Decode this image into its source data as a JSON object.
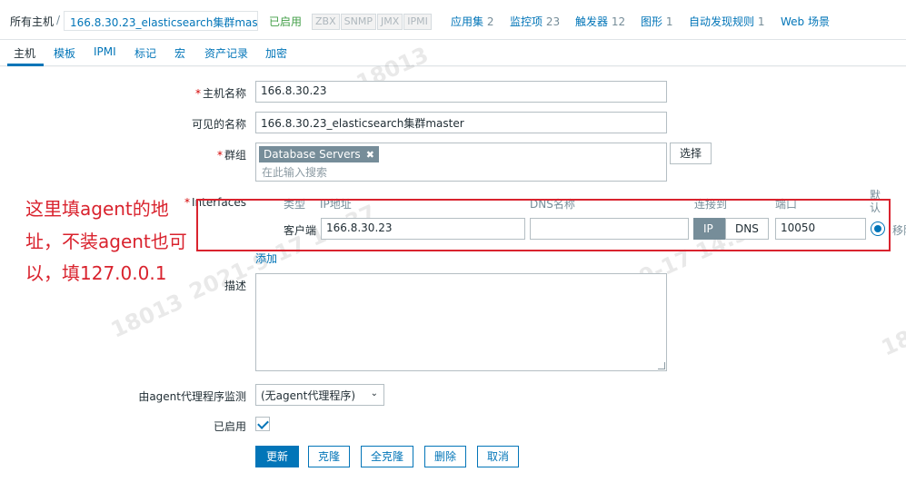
{
  "breadcrumb": {
    "all_hosts": "所有主机",
    "separator": "/",
    "current_host": "166.8.30.23_elasticsearch集群mas..."
  },
  "status": {
    "enabled": "已启用"
  },
  "availability": [
    "ZBX",
    "SNMP",
    "JMX",
    "IPMI"
  ],
  "host_links": [
    {
      "label": "应用集",
      "count": "2"
    },
    {
      "label": "监控项",
      "count": "23"
    },
    {
      "label": "触发器",
      "count": "12"
    },
    {
      "label": "图形",
      "count": "1"
    },
    {
      "label": "自动发现规则",
      "count": "1"
    },
    {
      "label": "Web 场景",
      "count": ""
    }
  ],
  "tabs": [
    "主机",
    "模板",
    "IPMI",
    "标记",
    "宏",
    "资产记录",
    "加密"
  ],
  "form": {
    "hostname_label": "主机名称",
    "hostname_value": "166.8.30.23",
    "visible_name_label": "可见的名称",
    "visible_name_value": "166.8.30.23_elasticsearch集群master",
    "groups_label": "群组",
    "group_chip": "Database Servers",
    "groups_placeholder": "在此输入搜索",
    "select_button": "选择",
    "interfaces_label": "Interfaces",
    "interface_headers": {
      "type": "类型",
      "ip": "IP地址",
      "dns": "DNS名称",
      "connect": "连接到",
      "port": "端口",
      "default": "默认"
    },
    "interface_row": {
      "type": "客户端",
      "ip": "166.8.30.23",
      "dns": "",
      "ip_btn": "IP",
      "dns_btn": "DNS",
      "port": "10050",
      "remove": "移除"
    },
    "add_link": "添加",
    "description_label": "描述",
    "proxy_label": "由agent代理程序监测",
    "proxy_value": "(无agent代理程序)",
    "enabled_label": "已启用",
    "buttons": {
      "update": "更新",
      "clone": "克隆",
      "full_clone": "全克隆",
      "delete": "删除",
      "cancel": "取消"
    }
  },
  "annotation": {
    "lines": [
      "这里填agent的地",
      "址，不装agent也可",
      "以，填127.0.0.1"
    ]
  },
  "watermarks": [
    "18013",
    "2021-9-17 14:37",
    "18013",
    "2021-9-17 14:37",
    "18013",
    "18"
  ],
  "colors": {
    "link": "#0275b8",
    "enabled": "#429e47",
    "annotation": "#d9232e",
    "required": "#d40000"
  }
}
